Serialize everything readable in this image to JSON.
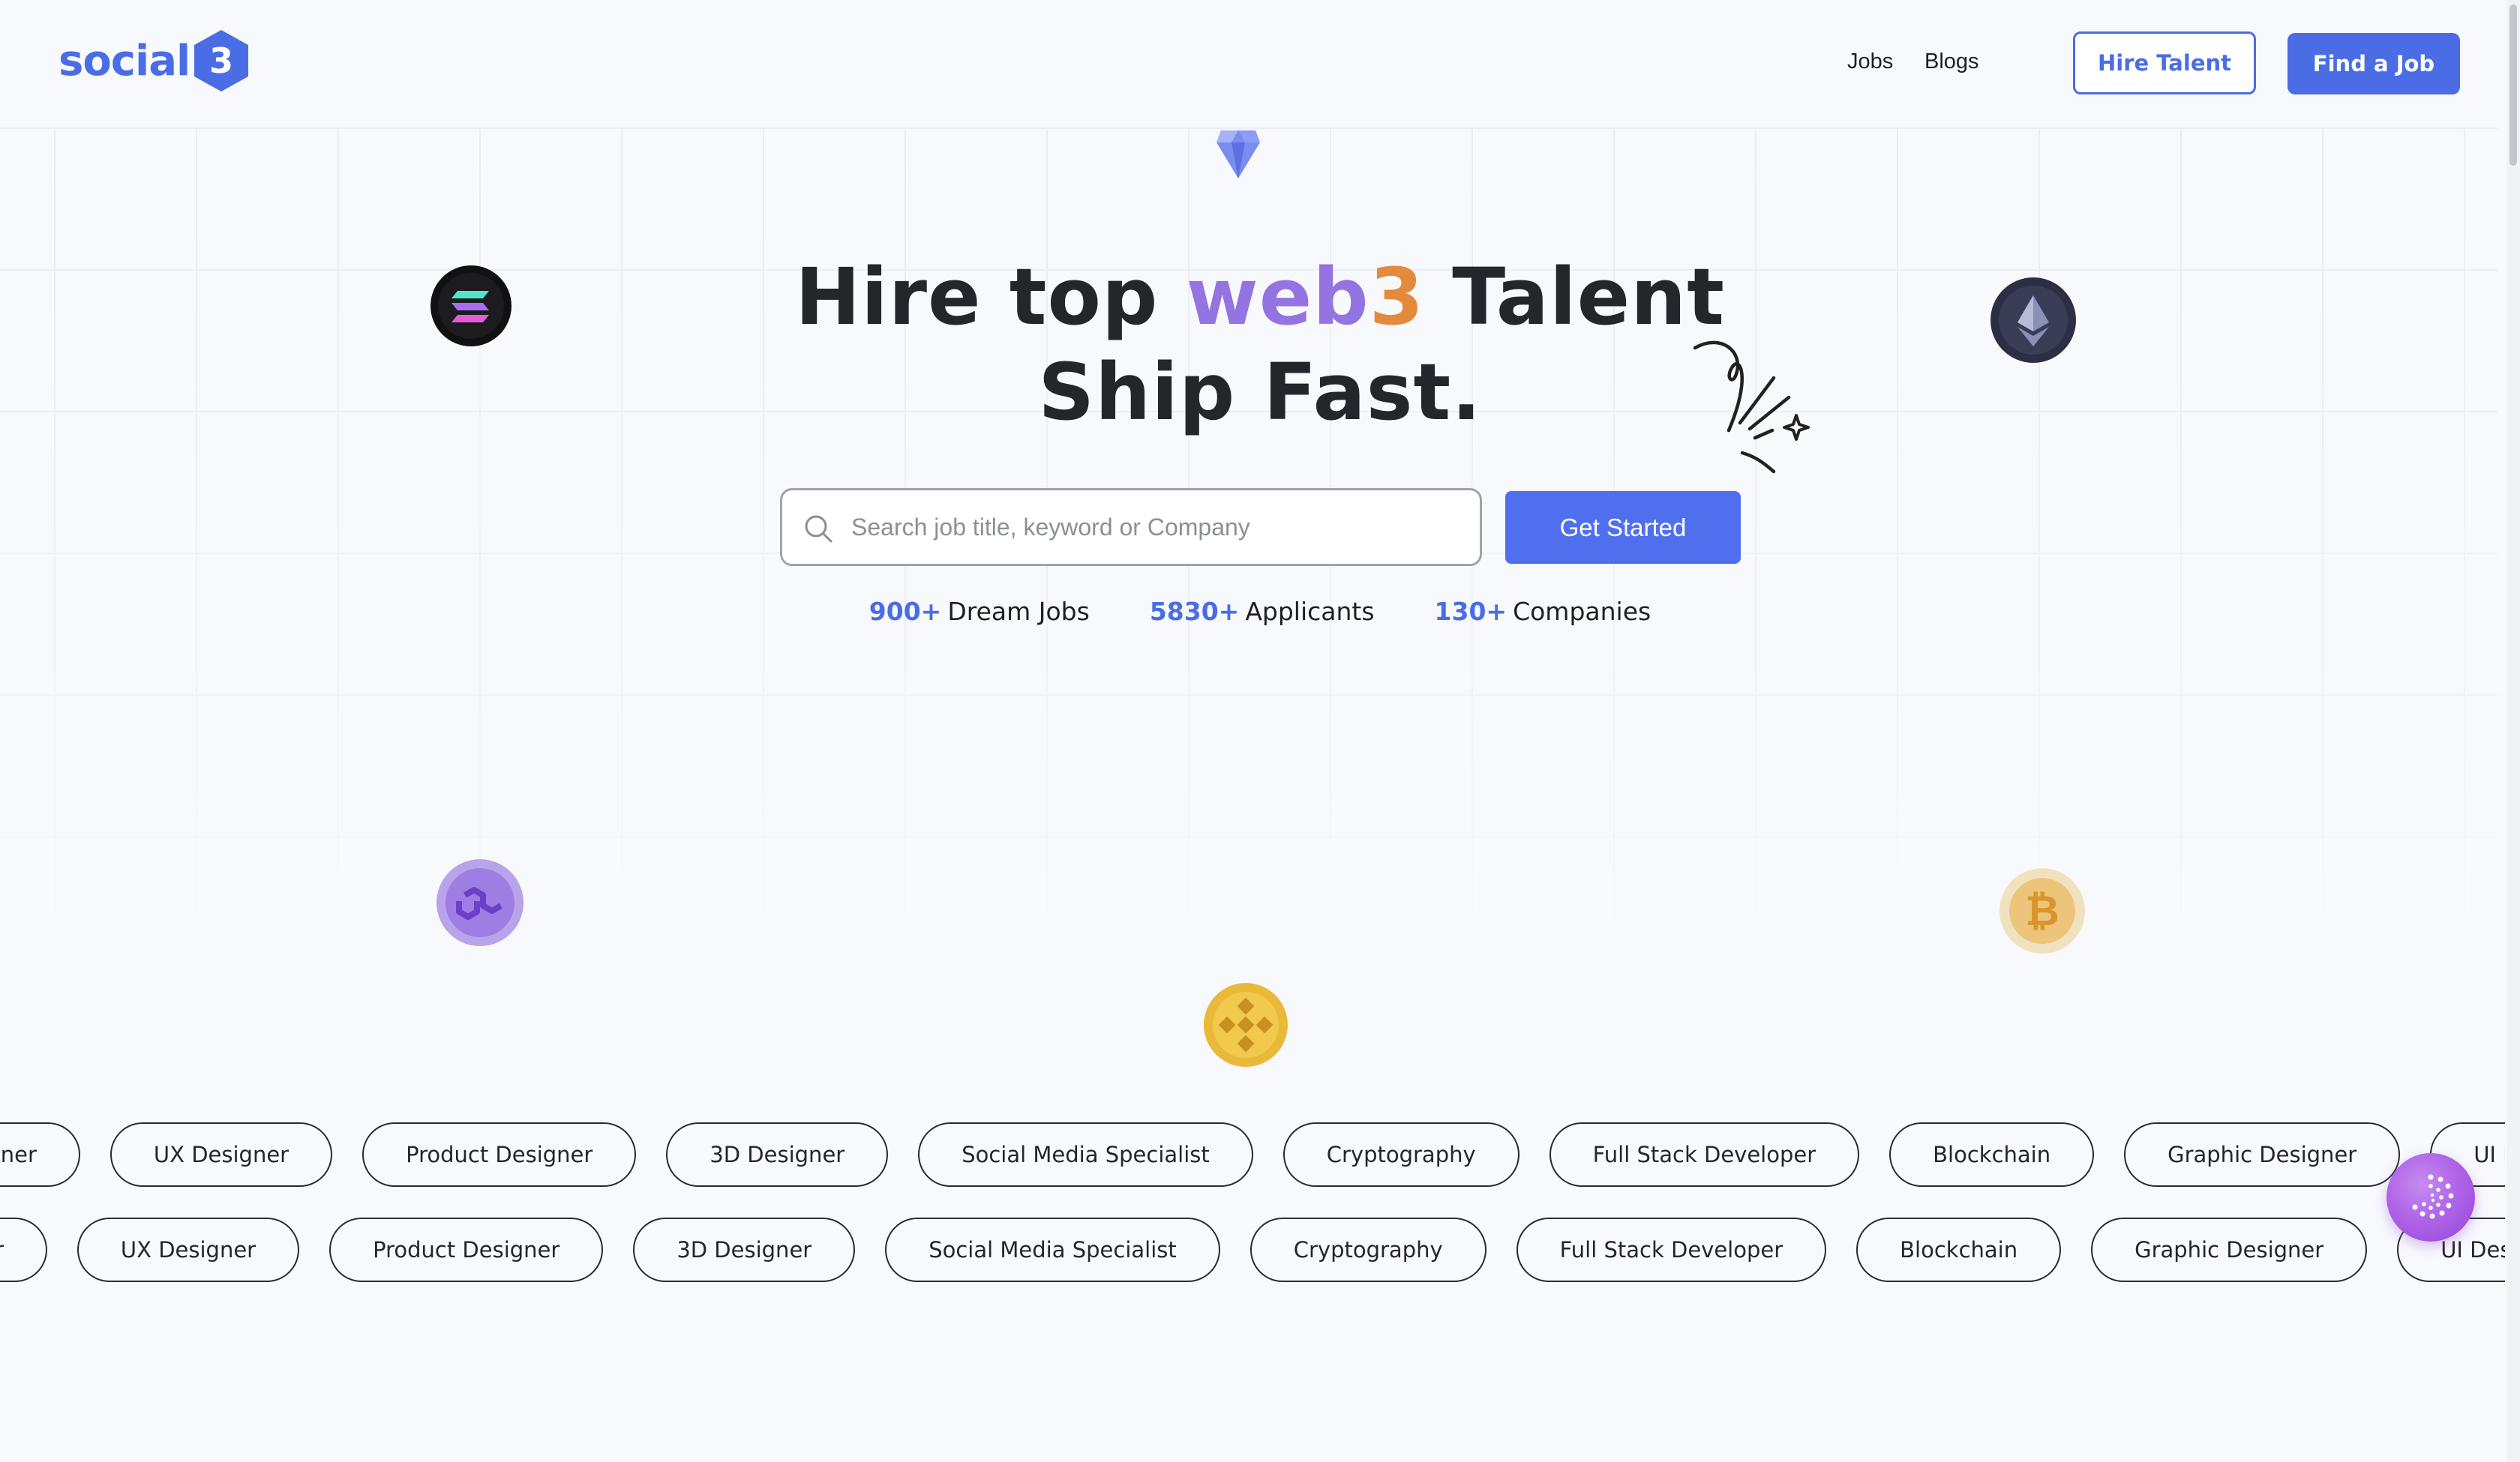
{
  "header": {
    "logo_text": "social",
    "logo_badge": "3",
    "nav": [
      {
        "label": "Jobs"
      },
      {
        "label": "Blogs"
      }
    ],
    "hire_talent_label": "Hire Talent",
    "find_job_label": "Find a Job"
  },
  "hero": {
    "line1_before": "Hire top ",
    "line1_web": "web",
    "line1_three": "3",
    "line1_after": " Talent",
    "line2": "Ship Fast."
  },
  "search": {
    "placeholder": "Search job title, keyword or Company",
    "value": "",
    "button_label": "Get Started"
  },
  "stats": [
    {
      "number": "900+",
      "label": "Dream Jobs"
    },
    {
      "number": "5830+",
      "label": "Applicants"
    },
    {
      "number": "130+",
      "label": "Companies"
    }
  ],
  "tags": {
    "row1": [
      "UI Designer",
      "UX Designer",
      "Product Designer",
      "3D Designer",
      "Social Media Specialist",
      "Cryptography",
      "Full Stack Developer",
      "Blockchain",
      "Graphic Designer",
      "UI Designer"
    ],
    "row2": [
      "UI Designer",
      "UX Designer",
      "Product Designer",
      "3D Designer",
      "Social Media Specialist",
      "Cryptography",
      "Full Stack Developer",
      "Blockchain",
      "Graphic Designer",
      "UI Designer"
    ]
  },
  "colors": {
    "brand": "#4a6de5",
    "accent_web": "#9473e2",
    "accent_three": "#e48a3c",
    "background": "#f8f9fd"
  },
  "icons": [
    "logo-hexagon-icon",
    "search-icon",
    "diamond-icon",
    "solana-coin-icon",
    "ethereum-coin-icon",
    "polygon-coin-icon",
    "bitcoin-coin-icon",
    "binance-coin-icon",
    "sparkle-doodle-icon",
    "chat-icon"
  ]
}
